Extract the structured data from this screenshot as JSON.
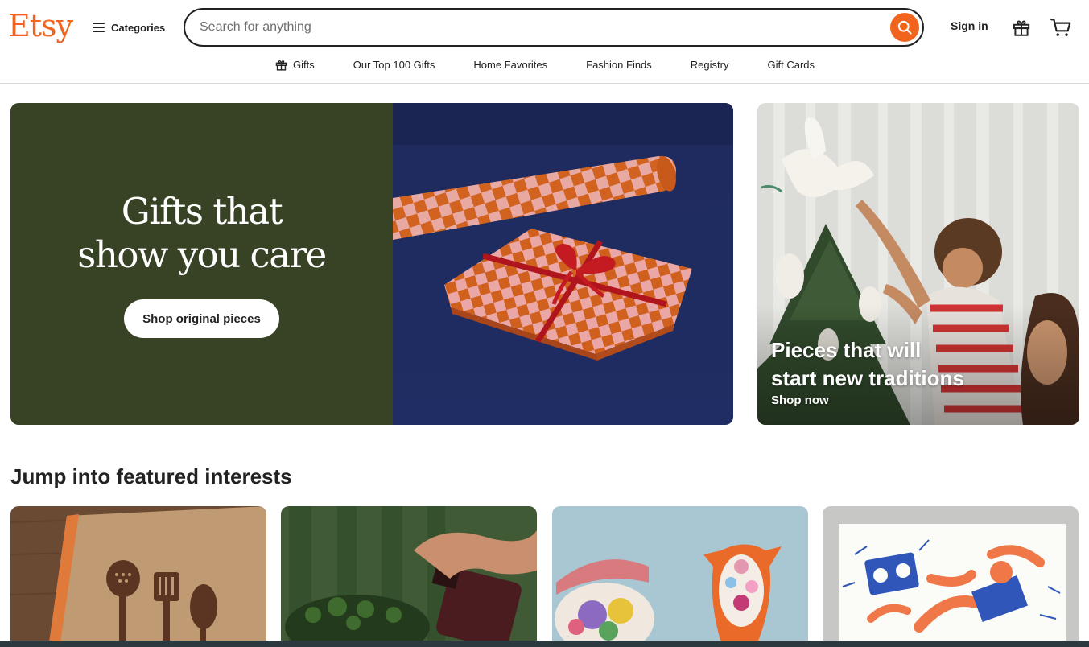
{
  "header": {
    "logo": "Etsy",
    "categories_label": "Categories",
    "search_placeholder": "Search for anything",
    "signin_label": "Sign in"
  },
  "nav": {
    "items": [
      "Gifts",
      "Our Top 100 Gifts",
      "Home Favorites",
      "Fashion Finds",
      "Registry",
      "Gift Cards"
    ]
  },
  "hero": {
    "title_line1": "Gifts that",
    "title_line2": "show you care",
    "cta": "Shop original pieces"
  },
  "side_card": {
    "title_line1": "Pieces that will",
    "title_line2": "start new traditions",
    "link": "Shop now"
  },
  "featured": {
    "title": "Jump into featured interests"
  },
  "colors": {
    "brand": "#f1641e",
    "hero_green": "#384224",
    "hero_navy": "#1f2d64"
  }
}
